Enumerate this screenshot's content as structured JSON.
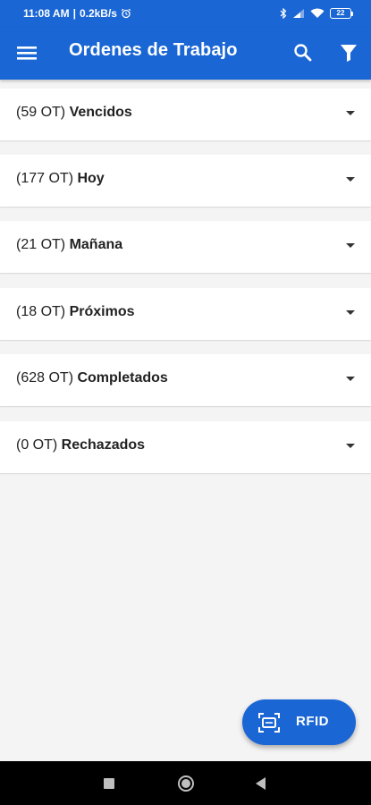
{
  "status_bar": {
    "time": "11:08 AM",
    "speed": "0.2kB/s",
    "battery": "22"
  },
  "app_bar": {
    "title": "Ordenes de Trabajo"
  },
  "sections": [
    {
      "count": "(59 OT)",
      "name": "Vencidos"
    },
    {
      "count": "(177 OT)",
      "name": "Hoy"
    },
    {
      "count": "(21 OT)",
      "name": "Mañana"
    },
    {
      "count": "(18 OT)",
      "name": "Próximos"
    },
    {
      "count": "(628 OT)",
      "name": "Completados"
    },
    {
      "count": "(0 OT)",
      "name": "Rechazados"
    }
  ],
  "fab": {
    "label": "RFID"
  },
  "colors": {
    "primary": "#1a66d4",
    "background": "#f4f4f4"
  }
}
